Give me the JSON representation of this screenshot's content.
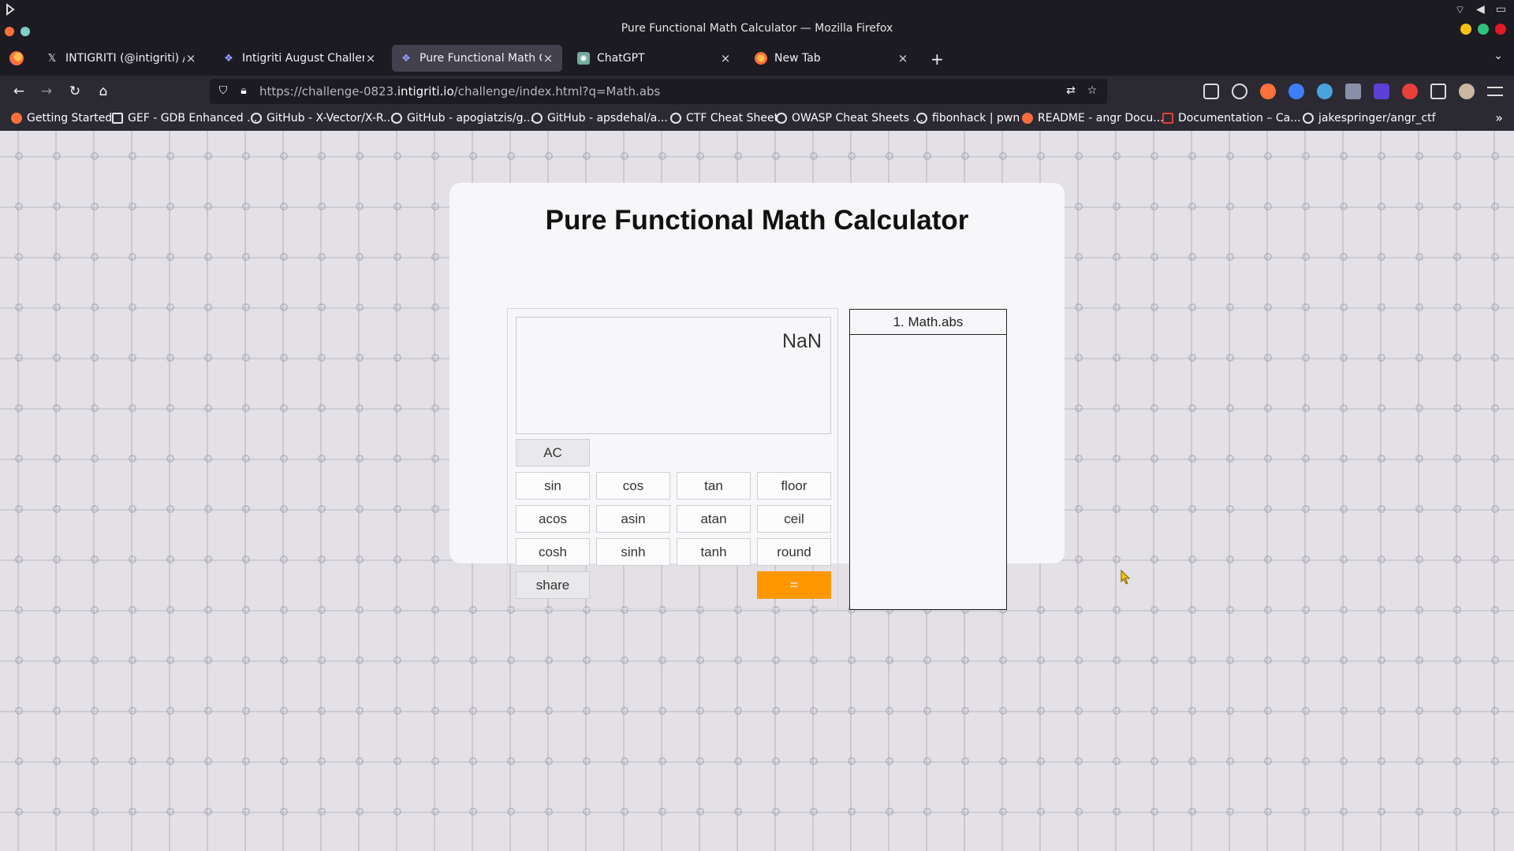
{
  "window": {
    "title": "Pure Functional Math Calculator — Mozilla Firefox"
  },
  "tabs": [
    {
      "label": "INTIGRITI (@intigriti) / X",
      "icon": "x-logo-icon",
      "active": false
    },
    {
      "label": "Intigriti August Challenge",
      "icon": "intigriti-icon",
      "active": false
    },
    {
      "label": "Pure Functional Math Calcu",
      "icon": "intigriti-icon",
      "active": true
    },
    {
      "label": "ChatGPT",
      "icon": "chatgpt-icon",
      "active": false
    },
    {
      "label": "New Tab",
      "icon": "firefox-icon",
      "active": false
    }
  ],
  "urlbar": {
    "url_prefix": "https://challenge-0823.",
    "url_domain": "intigriti.io",
    "url_suffix": "/challenge/index.html?q=Math.abs"
  },
  "bookmarks": [
    "Getting Started",
    "GEF - GDB Enhanced ...",
    "GitHub - X-Vector/X-R...",
    "GitHub - apogiatzis/g...",
    "GitHub - apsdehal/a...",
    "CTF Cheat Sheet",
    "OWASP Cheat Sheets ...",
    "fibonhack | pwn",
    "README - angr Docu...",
    "Documentation – Ca...",
    "jakespringer/angr_ctf"
  ],
  "calculator": {
    "title": "Pure Functional Math Calculator",
    "display_value": "NaN",
    "clear_label": "AC",
    "functions": [
      [
        "sin",
        "cos",
        "tan",
        "floor"
      ],
      [
        "acos",
        "asin",
        "atan",
        "ceil"
      ],
      [
        "cosh",
        "sinh",
        "tanh",
        "round"
      ]
    ],
    "share_label": "share",
    "equals_label": "="
  },
  "history": {
    "items": [
      "1. Math.abs"
    ]
  },
  "colors": {
    "accent_orange": "#ff9800",
    "browser_dark": "#1c1b22",
    "toolbar": "#2b2a33"
  }
}
